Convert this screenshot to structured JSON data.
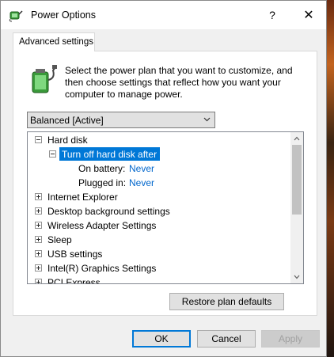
{
  "window": {
    "title": "Power Options",
    "help_label": "?",
    "close_label": "✕"
  },
  "tab": {
    "label": "Advanced settings"
  },
  "intro_text": "Select the power plan that you want to customize, and then choose settings that reflect how you want your computer to manage power.",
  "plan_select": {
    "value": "Balanced [Active]"
  },
  "tree": {
    "items": [
      {
        "label": "Hard disk",
        "expanded": true
      },
      {
        "label": "Turn off hard disk after",
        "expanded": true,
        "selected": true
      },
      {
        "label": "On battery:",
        "value": "Never"
      },
      {
        "label": "Plugged in:",
        "value": "Never"
      },
      {
        "label": "Internet Explorer",
        "expanded": false
      },
      {
        "label": "Desktop background settings",
        "expanded": false
      },
      {
        "label": "Wireless Adapter Settings",
        "expanded": false
      },
      {
        "label": "Sleep",
        "expanded": false
      },
      {
        "label": "USB settings",
        "expanded": false
      },
      {
        "label": "Intel(R) Graphics Settings",
        "expanded": false
      },
      {
        "label": "PCI Express",
        "expanded": false
      }
    ]
  },
  "buttons": {
    "restore": "Restore plan defaults",
    "ok": "OK",
    "cancel": "Cancel",
    "apply": "Apply"
  },
  "colors": {
    "selection": "#0078d7",
    "link": "#0066cc"
  },
  "icons": {
    "title": "power-options-icon",
    "panel": "battery-plug-icon"
  }
}
